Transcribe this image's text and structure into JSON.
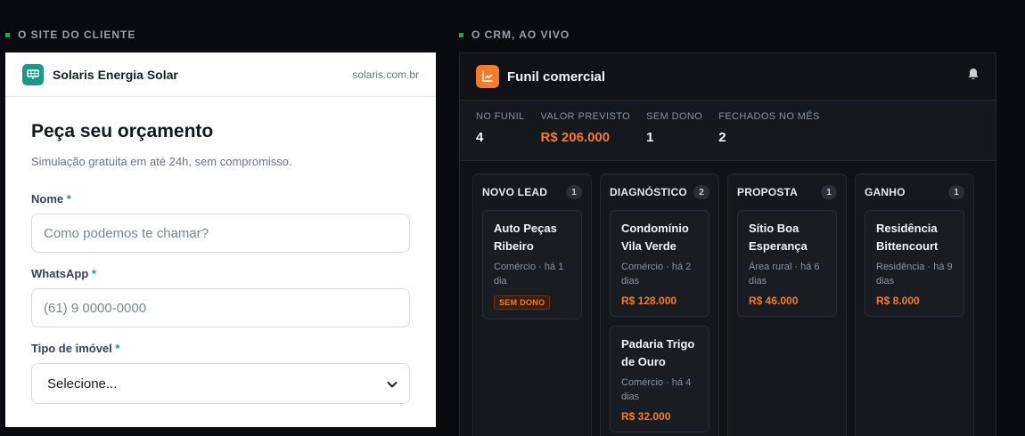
{
  "left_section": {
    "label": "O SITE DO CLIENTE"
  },
  "right_section": {
    "label": "O CRM, AO VIVO"
  },
  "site": {
    "brand_name": "Solaris Energia Solar",
    "domain": "solaris.com.br",
    "form": {
      "title": "Peça seu orçamento",
      "subtitle": "Simulação gratuita em até 24h, sem compromisso.",
      "required_mark": "*",
      "fields": [
        {
          "label": "Nome",
          "placeholder": "Como podemos te chamar?"
        },
        {
          "label": "WhatsApp",
          "placeholder": "(61) 9 0000-0000"
        },
        {
          "label": "Tipo de imóvel",
          "selected": "Selecione..."
        }
      ]
    }
  },
  "crm": {
    "title": "Funil comercial",
    "accent": "#f47c2c",
    "stats": [
      {
        "label": "NO FUNIL",
        "value": "4"
      },
      {
        "label": "VALOR PREVISTO",
        "value": "R$ 206.000"
      },
      {
        "label": "SEM DONO",
        "value": "1"
      },
      {
        "label": "FECHADOS NO MÊS",
        "value": "2"
      }
    ],
    "columns": [
      {
        "name": "NOVO LEAD",
        "count": "1",
        "cards": [
          {
            "title": "Auto Peças Ribeiro",
            "meta": "Comércio · há 1 dia",
            "tag": "SEM DONO"
          }
        ]
      },
      {
        "name": "DIAGNÓSTICO",
        "count": "2",
        "cards": [
          {
            "title": "Condomínio Vila Verde",
            "meta": "Comércio · há 2 dias",
            "value": "R$ 128.000"
          },
          {
            "title": "Padaria Trigo de Ouro",
            "meta": "Comércio · há 4 dias",
            "value": "R$ 32.000"
          }
        ]
      },
      {
        "name": "PROPOSTA",
        "count": "1",
        "cards": [
          {
            "title": "Sítio Boa Esperança",
            "meta": "Área rural · há 6 dias",
            "value": "R$ 46.000"
          }
        ]
      },
      {
        "name": "GANHO",
        "count": "1",
        "cards": [
          {
            "title": "Residência Bittencourt",
            "meta": "Residência · há 9 dias",
            "value": "R$ 8.000"
          }
        ]
      }
    ]
  }
}
